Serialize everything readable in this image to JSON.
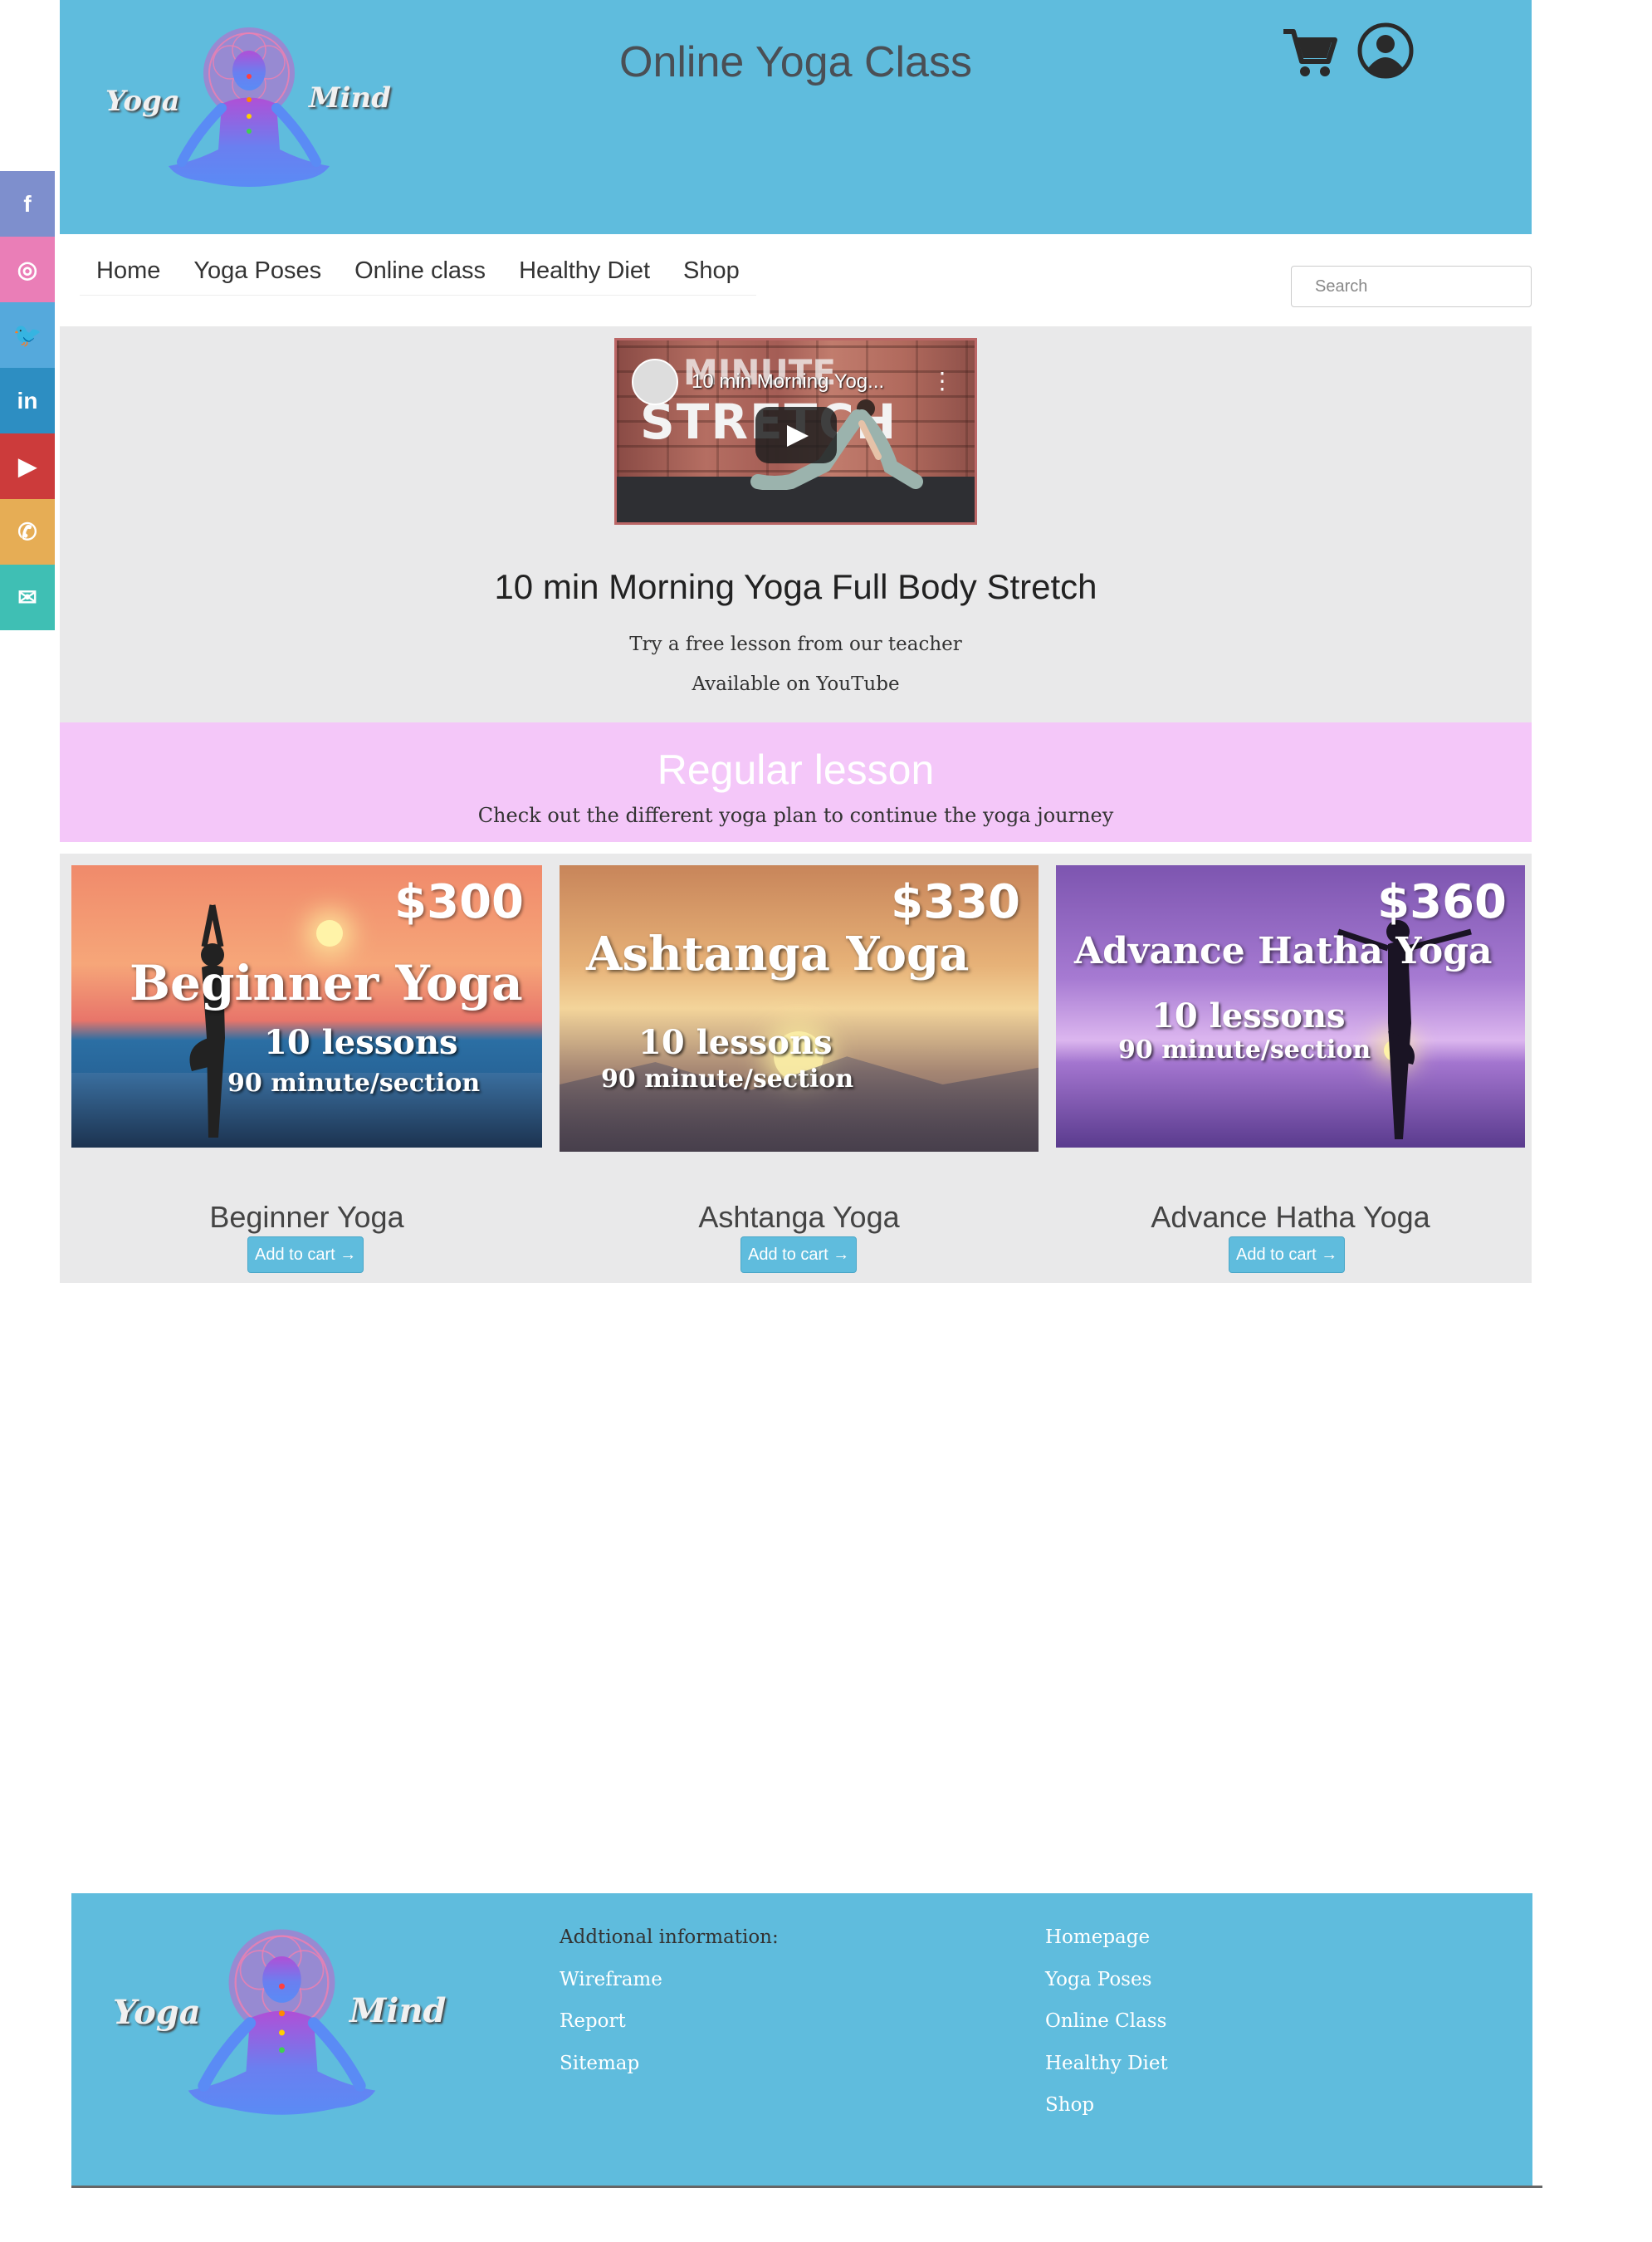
{
  "header": {
    "logo_left_word": "Yoga",
    "logo_right_word": "Mind",
    "title": "Online Yoga Class"
  },
  "social": [
    {
      "icon": "facebook-icon",
      "glyph": "f",
      "color": "#7e8fcd"
    },
    {
      "icon": "instagram-icon",
      "glyph": "◎",
      "color": "#ea7eb7"
    },
    {
      "icon": "twitter-icon",
      "glyph": "🐦",
      "color": "#55a9dc"
    },
    {
      "icon": "linkedin-icon",
      "glyph": "in",
      "color": "#2d8ec2"
    },
    {
      "icon": "youtube-icon",
      "glyph": "▶",
      "color": "#cc3b3b"
    },
    {
      "icon": "phone-icon",
      "glyph": "✆",
      "color": "#e6ad55"
    },
    {
      "icon": "email-icon",
      "glyph": "✉",
      "color": "#3fbfb4"
    }
  ],
  "nav": {
    "items": [
      "Home",
      "Yoga Poses",
      "Online class",
      "Healthy Diet",
      "Shop"
    ],
    "search_placeholder": "Search"
  },
  "video": {
    "thumbnail_title": "10 min Morning Yog...",
    "thumbnail_overlay_top": "MINUTE",
    "thumbnail_overlay_main": "STRETCH",
    "heading": "10 min Morning Yoga Full Body Stretch",
    "line1": "Try a free lesson from our teacher",
    "line2": "Available on YouTube"
  },
  "regular": {
    "title": "Regular lesson",
    "subtitle": "Check out the different yoga plan to continue the yoga journey"
  },
  "products": [
    {
      "price": "$300",
      "image_title": "Beginner Yoga",
      "lessons": "10 lessons",
      "duration": "90 minute/section",
      "name": "Beginner Yoga",
      "button": "Add to cart →"
    },
    {
      "price": "$330",
      "image_title": "Ashtanga Yoga",
      "lessons": "10 lessons",
      "duration": "90 minute/section",
      "name": "Ashtanga Yoga",
      "button": "Add to cart →"
    },
    {
      "price": "$360",
      "image_title": "Advance Hatha Yoga",
      "lessons": "10 lessons",
      "duration": "90 minute/section",
      "name": "Advance Hatha Yoga",
      "button": "Add to cart →"
    }
  ],
  "footer": {
    "logo_left_word": "Yoga",
    "logo_right_word": "Mind",
    "info_heading": "Addtional information:",
    "info_links": [
      "Wireframe",
      "Report",
      "Sitemap"
    ],
    "nav_links": [
      "Homepage",
      "Yoga Poses",
      "Online Class",
      "Healthy Diet",
      "Shop"
    ]
  },
  "colors": {
    "header_bg": "#5fbcdd",
    "banner_bg": "#f4c7f9",
    "section_bg": "#e9e9ea"
  }
}
